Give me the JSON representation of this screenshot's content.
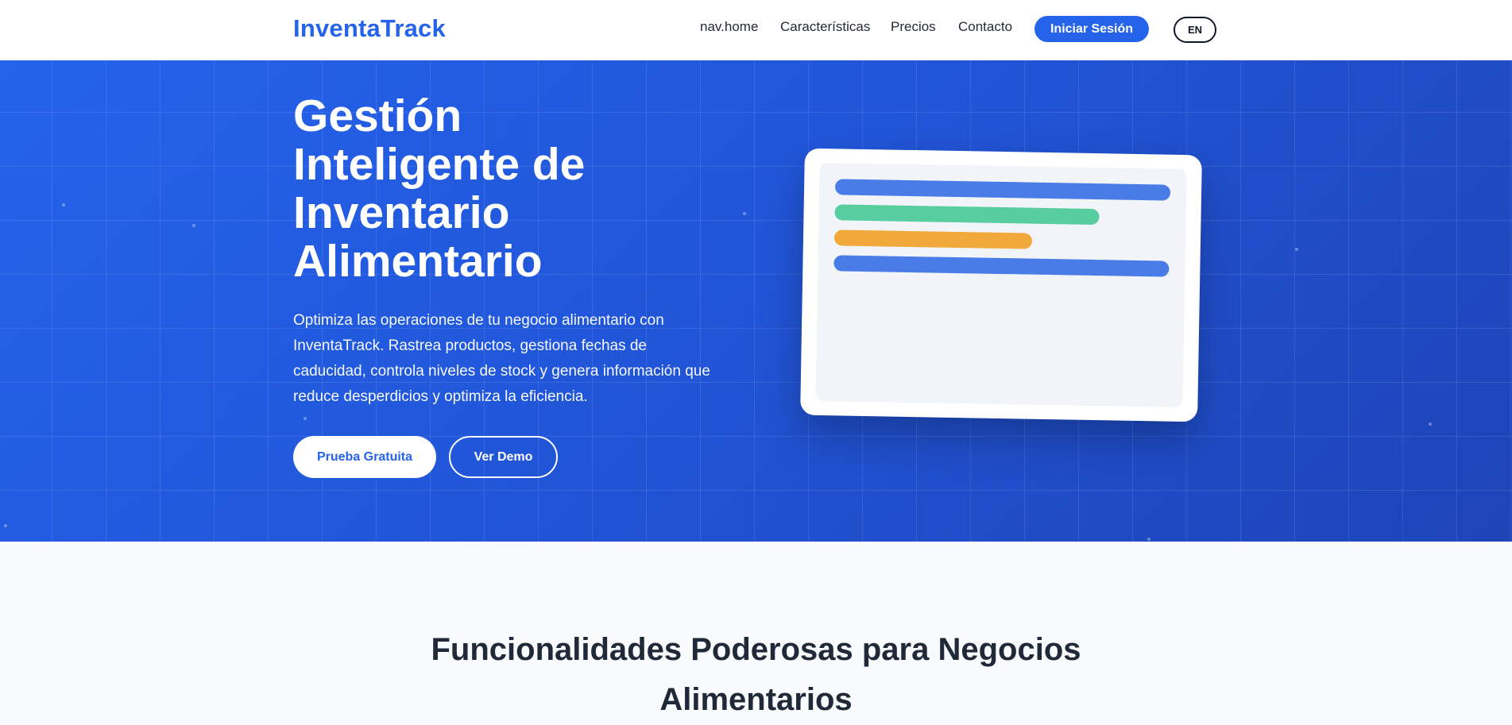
{
  "brand": "InventaTrack",
  "nav": {
    "links": [
      {
        "label": "nav.home"
      },
      {
        "label": "Características"
      },
      {
        "label": "Precios"
      },
      {
        "label": "Contacto"
      }
    ],
    "login_label": "Iniciar Sesión",
    "lang_label": "EN"
  },
  "hero": {
    "title": "Gestión Inteligente de Inventario Alimentario",
    "description": "Optimiza las operaciones de tu negocio alimentario con InventaTrack. Rastrea productos, gestiona fechas de caducidad, controla niveles de stock y genera información que reduce desperdicios y optimiza la eficiencia.",
    "primary_cta": "Prueba Gratuita",
    "secondary_cta": "Ver Demo",
    "mockup_bars": [
      {
        "color": "#4a7ce8",
        "fill": 1.0
      },
      {
        "color": "#58cda0",
        "fill": 0.79
      },
      {
        "color": "#f2a93b",
        "fill": 0.59
      },
      {
        "color": "#4a7ce8",
        "fill": 1.0
      }
    ]
  },
  "features": {
    "title_line1": "Funcionalidades Poderosas para Negocios",
    "title_line2": "Alimentarios"
  },
  "colors": {
    "brand": "#2563eb",
    "hero_bg": "#2563eb",
    "text_dark": "#1f2937"
  }
}
